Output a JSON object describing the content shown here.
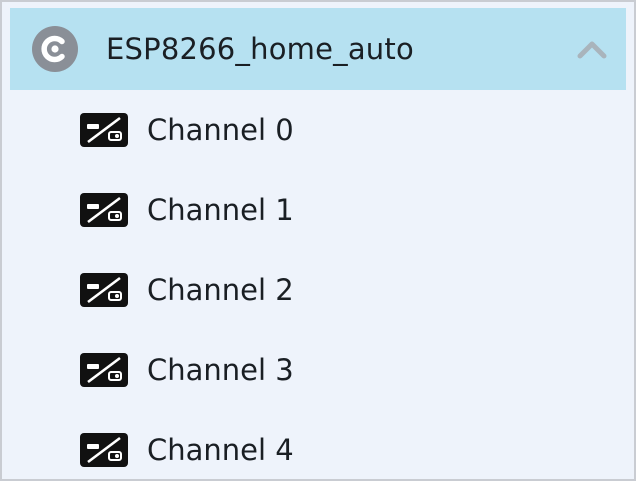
{
  "device": {
    "name": "ESP8266_home_auto",
    "logo_icon": "cayenne-logo-icon",
    "expanded": true,
    "collapse_icon": "chevron-up-icon"
  },
  "channels": [
    {
      "label": "Channel 0",
      "icon": "switch-widget-icon"
    },
    {
      "label": "Channel 1",
      "icon": "switch-widget-icon"
    },
    {
      "label": "Channel 2",
      "icon": "switch-widget-icon"
    },
    {
      "label": "Channel 3",
      "icon": "switch-widget-icon"
    },
    {
      "label": "Channel 4",
      "icon": "switch-widget-icon"
    }
  ],
  "colors": {
    "header_bg": "#b6e1f1",
    "panel_bg": "#eef3fb",
    "text": "#1a1f24",
    "logo": "#8a8f97",
    "chevron": "#a9b4bc"
  }
}
